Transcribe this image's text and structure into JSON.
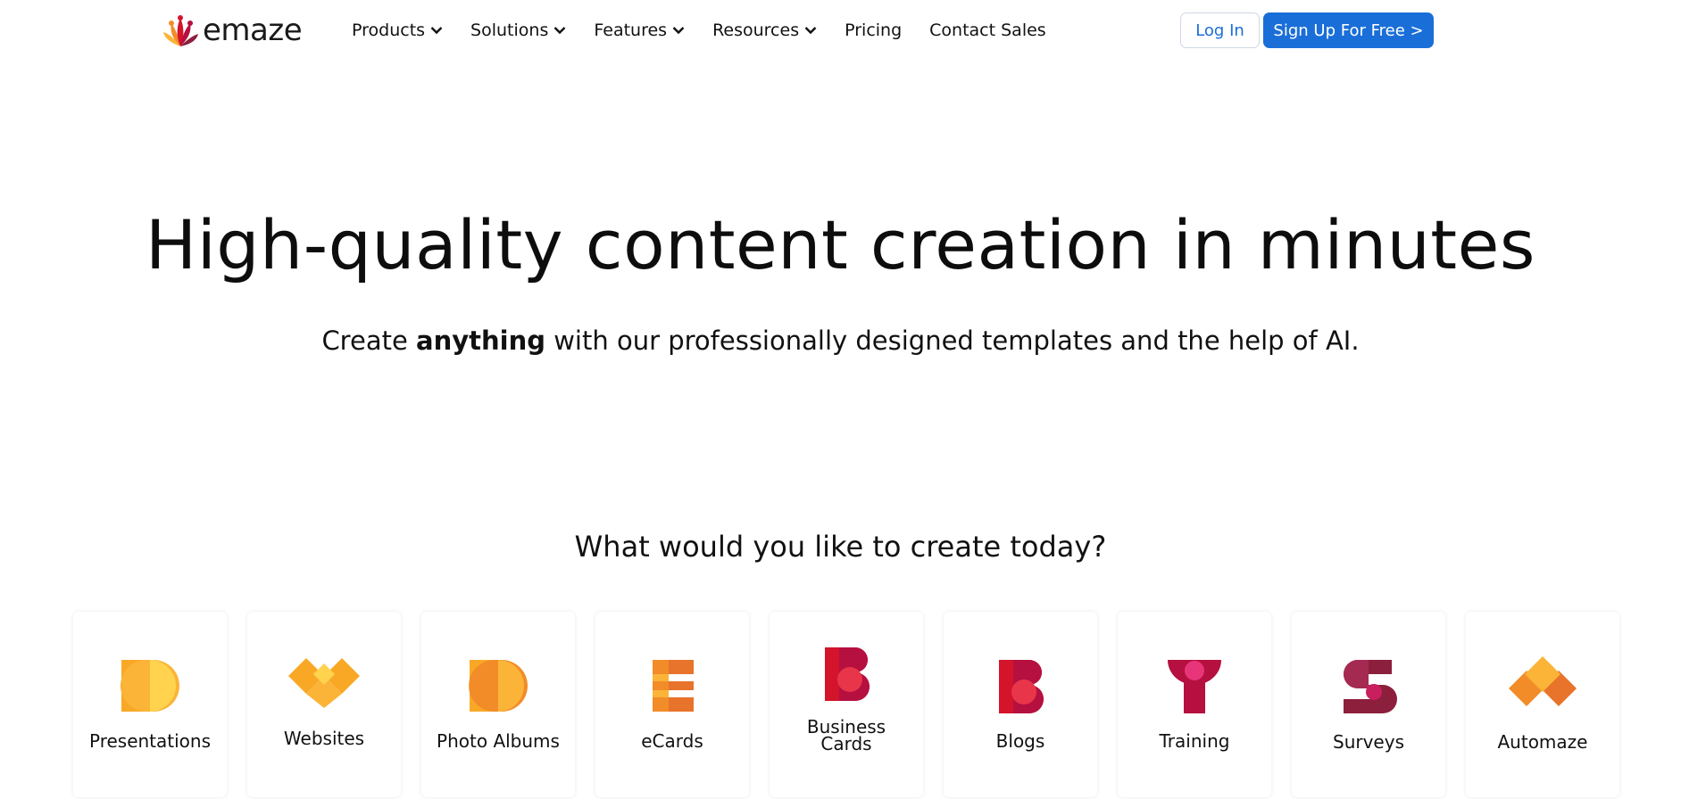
{
  "brand": {
    "name": "emaze"
  },
  "nav": {
    "items": [
      {
        "label": "Products",
        "dropdown": true
      },
      {
        "label": "Solutions",
        "dropdown": true
      },
      {
        "label": "Features",
        "dropdown": true
      },
      {
        "label": "Resources",
        "dropdown": true
      },
      {
        "label": "Pricing",
        "dropdown": false
      },
      {
        "label": "Contact Sales",
        "dropdown": false
      }
    ],
    "login_label": "Log In",
    "signup_label": "Sign Up For Free >"
  },
  "hero": {
    "title": "High-quality content creation in minutes",
    "subtitle_before": "Create ",
    "subtitle_bold": "anything",
    "subtitle_after": " with our professionally designed templates and the help of AI."
  },
  "create": {
    "heading": "What would you like to create today?",
    "cards": [
      {
        "label": "Presentations",
        "icon": "presentations-icon"
      },
      {
        "label": "Websites",
        "icon": "websites-icon"
      },
      {
        "label": "Photo Albums",
        "icon": "photo-albums-icon"
      },
      {
        "label": "eCards",
        "icon": "ecards-icon"
      },
      {
        "label": "Business Cards",
        "icon": "business-cards-icon"
      },
      {
        "label": "Blogs",
        "icon": "blogs-icon"
      },
      {
        "label": "Training",
        "icon": "training-icon"
      },
      {
        "label": "Surveys",
        "icon": "surveys-icon"
      },
      {
        "label": "Automaze",
        "icon": "automaze-icon"
      }
    ]
  },
  "colors": {
    "accent": "#1a6ed8",
    "yellow": "#fbb437",
    "orange": "#e8732a",
    "red": "#d3142a",
    "crimson": "#b5103f",
    "maroon": "#8c1f3c"
  }
}
